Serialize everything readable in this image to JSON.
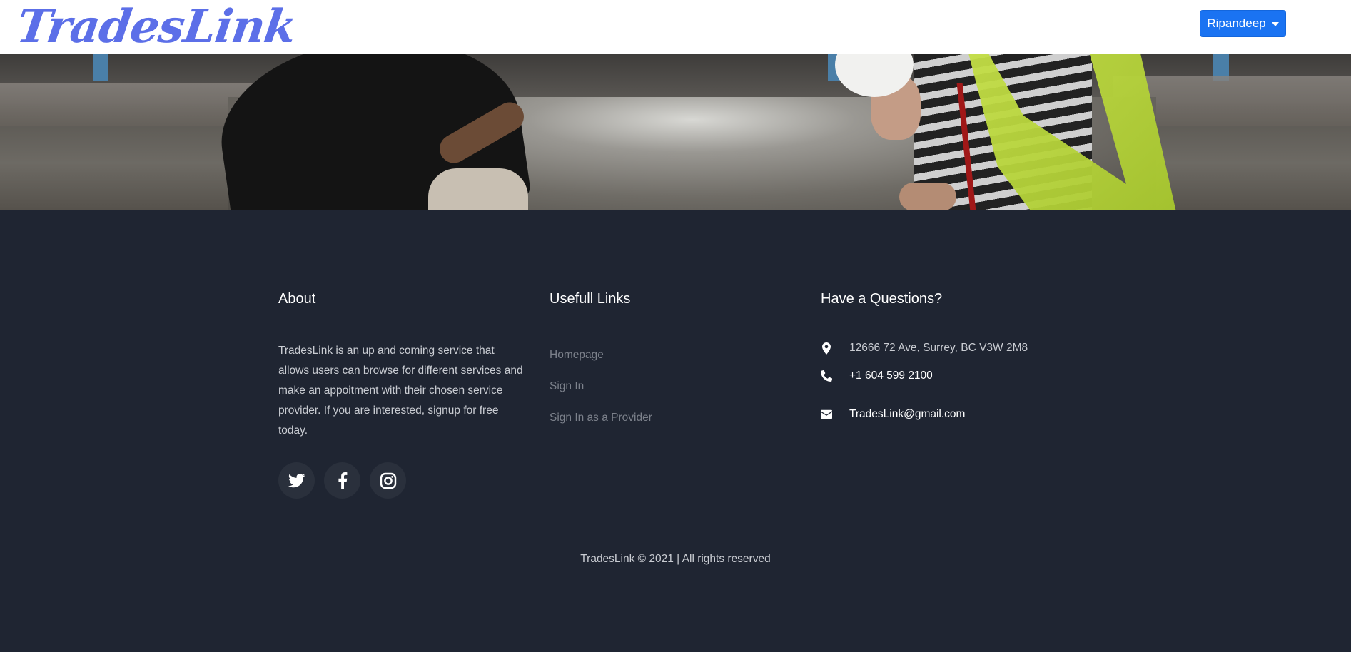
{
  "header": {
    "logo_text": "TradesLink",
    "user_menu_label": "Ripandeep",
    "colors": {
      "logo": "#5c6fe8",
      "user_button": "#1a73f2"
    }
  },
  "hero": {
    "image_description_icon": "hero-photo"
  },
  "footer": {
    "about": {
      "title": "About",
      "text": "TradesLink is an up and coming service that allows users can browse for different services and make an appoitment with their chosen service provider. If you are interested, signup for free today.",
      "social": [
        {
          "icon": "twitter-icon"
        },
        {
          "icon": "facebook-icon"
        },
        {
          "icon": "instagram-icon"
        }
      ]
    },
    "links": {
      "title": "Usefull Links",
      "items": [
        "Homepage",
        "Sign In",
        "Sign In as a Provider"
      ]
    },
    "contact": {
      "title": "Have a Questions?",
      "address": "12666 72 Ave, Surrey, BC V3W 2M8",
      "phone": "+1 604 599 2100",
      "email": "TradesLink@gmail.com",
      "icons": [
        "map-pin-icon",
        "phone-icon",
        "envelope-icon"
      ]
    },
    "copyright": "TradesLink © 2021 | All rights reserved",
    "colors": {
      "background": "#1f2532",
      "muted_text": "#7c818b",
      "text": "#c9ccd2"
    }
  }
}
